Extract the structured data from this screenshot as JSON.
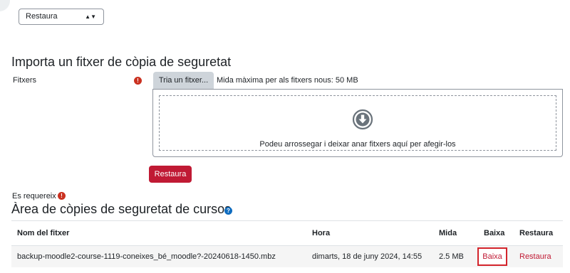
{
  "restore_select": {
    "value": "Restaura"
  },
  "import_section": {
    "title": "Importa un fitxer de còpia de seguretat",
    "files_label": "Fitxers",
    "required_icon": "!",
    "choose_button": "Tria un fitxer...",
    "max_size_text": "Mida màxima per als fitxers nous: 50 MB",
    "dropzone_text": "Podeu arrossegar i deixar anar fitxers aquí per afegir-los",
    "restore_button": "Restaura"
  },
  "required_note": {
    "text": "Es requereix",
    "icon": "!"
  },
  "course_backups": {
    "title": "Àrea de còpies de seguretat de cursos",
    "help_icon": "?",
    "headers": {
      "name": "Nom del fitxer",
      "time": "Hora",
      "size": "Mida",
      "download": "Baixa",
      "restore": "Restaura"
    },
    "rows": [
      {
        "name": "backup-moodle2-course-1119-coneixes_bé_moodle?-20240618-1450.mbz",
        "time": "dimarts, 18 de juny 2024, 14:55",
        "size": "2.5 MB",
        "download": "Baixa",
        "restore": "Restaura"
      }
    ]
  },
  "colors": {
    "primary": "#c01a34",
    "required": "#ca3120",
    "help": "#0f6cbf"
  }
}
